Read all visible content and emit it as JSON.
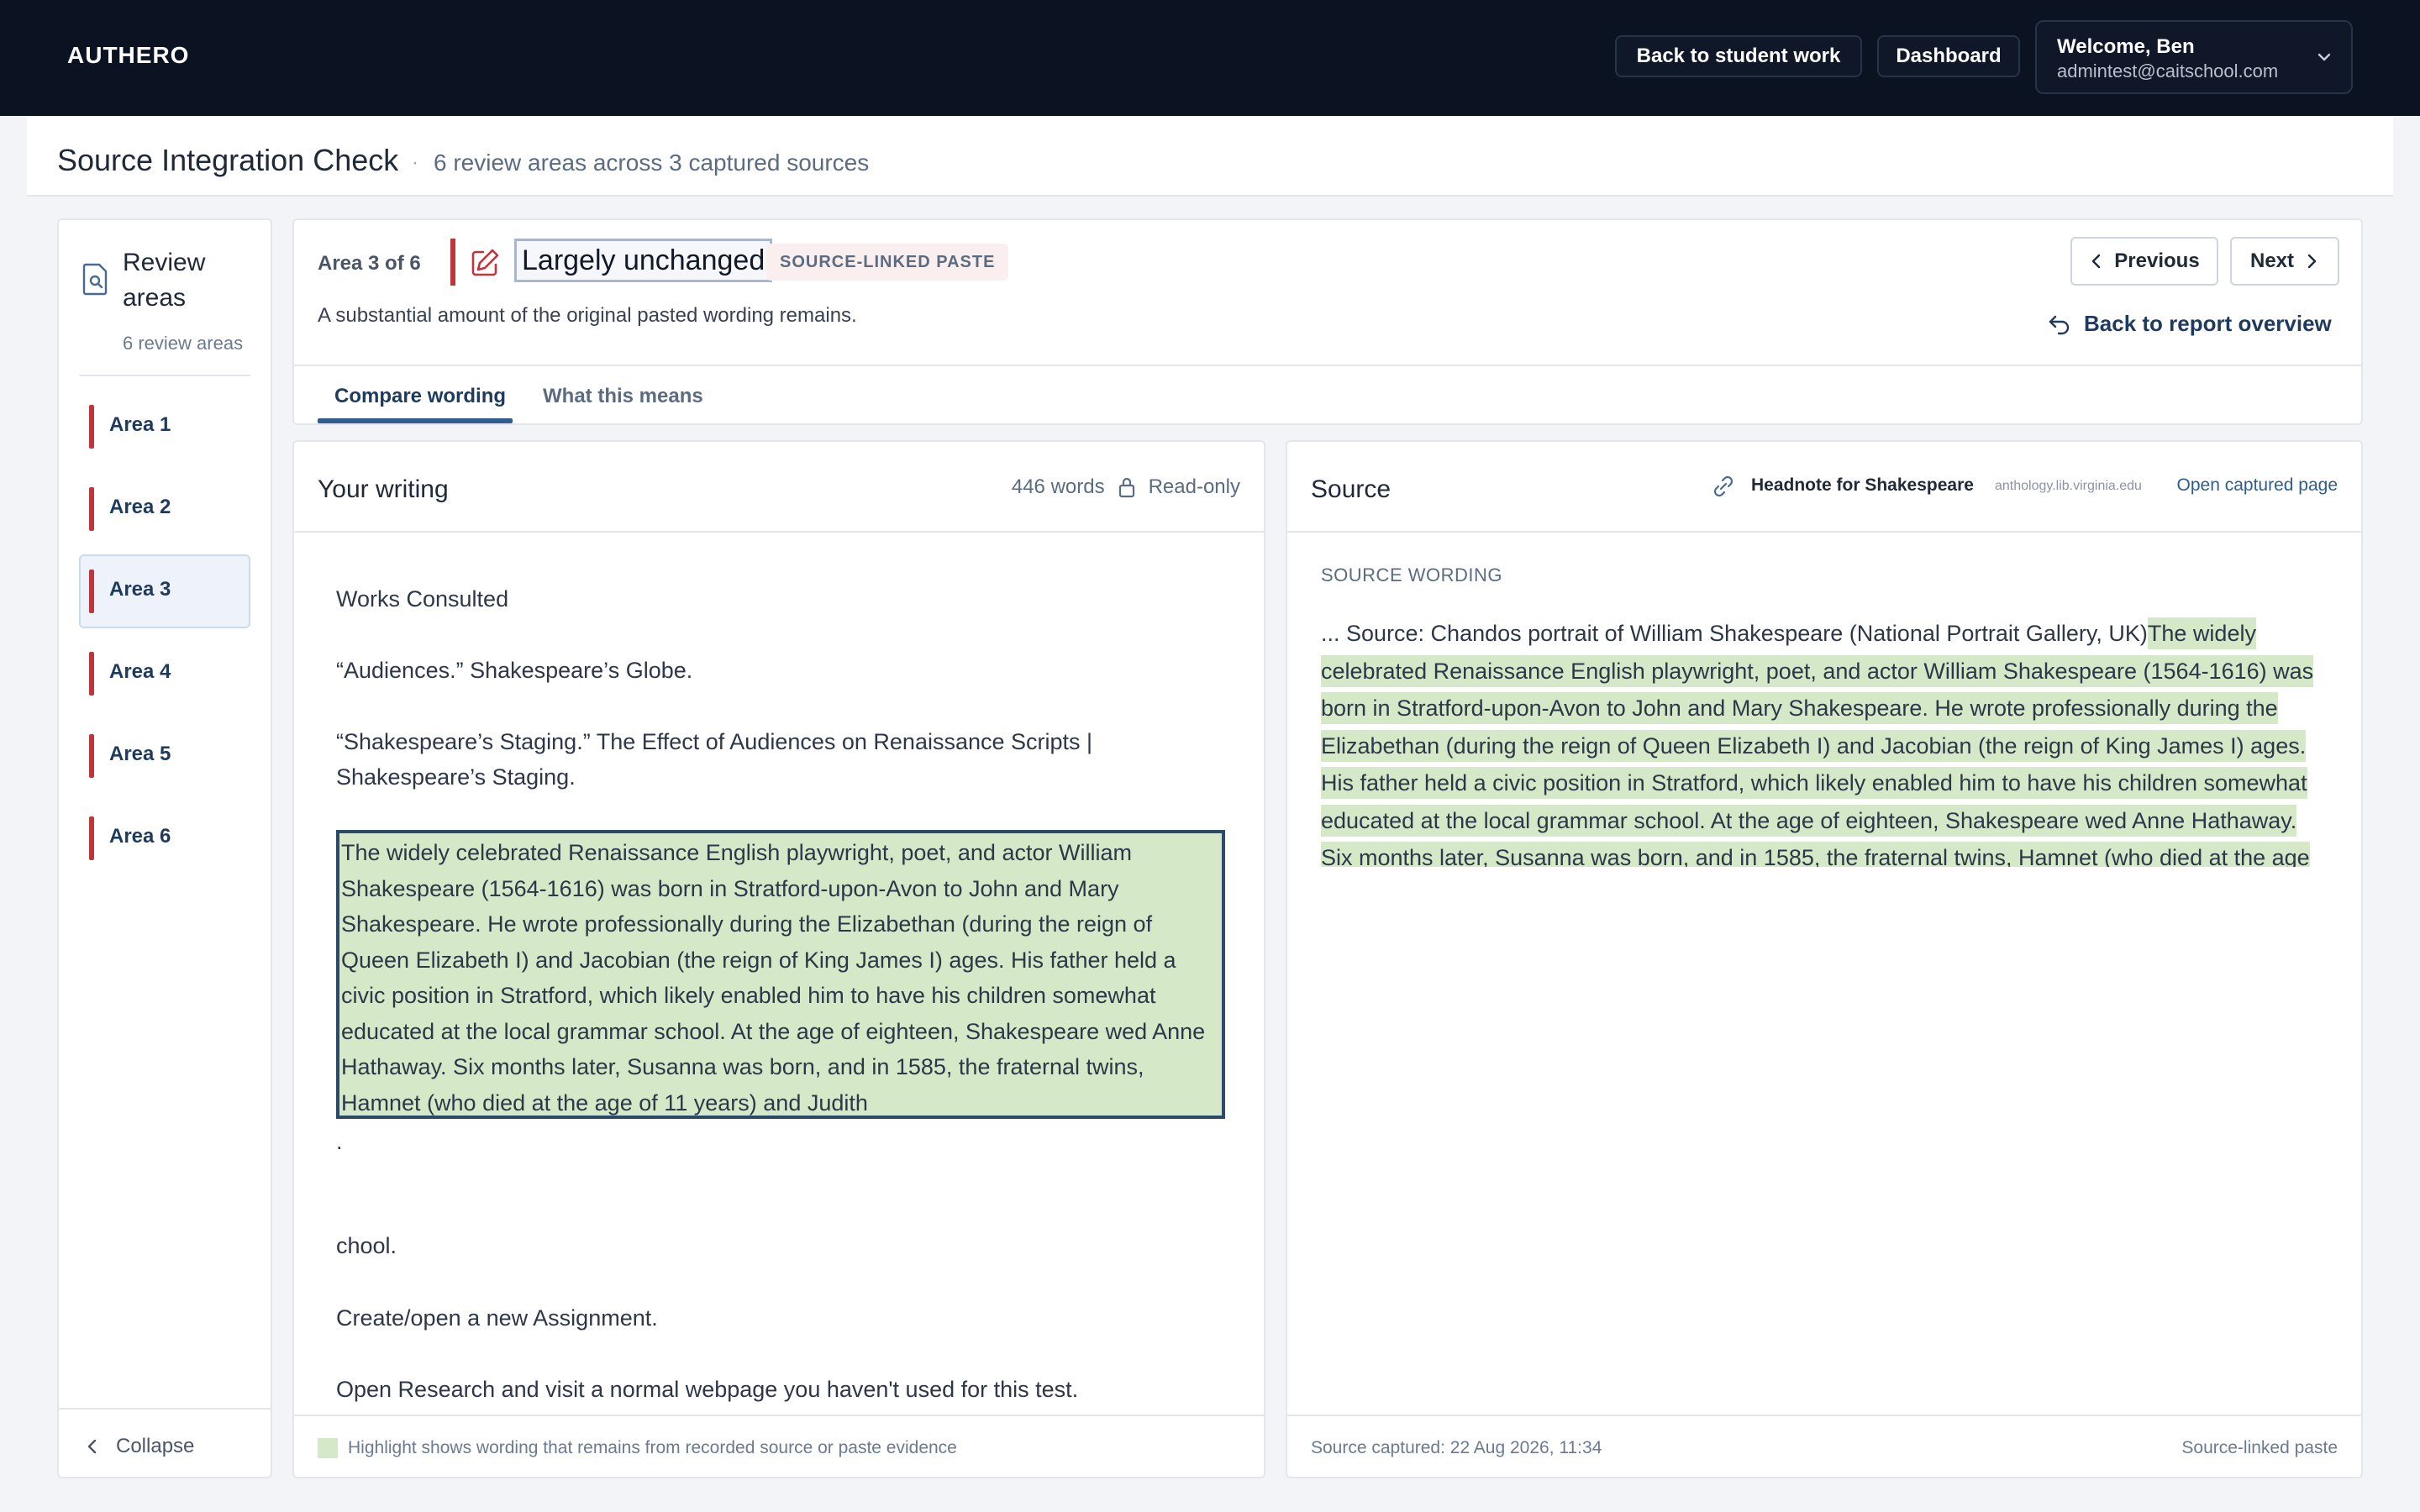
{
  "topbar": {
    "brand": "AUTHERO",
    "back_label": "Back to student work",
    "dashboard_label": "Dashboard",
    "user_greeting": "Welcome, Ben",
    "user_email": "admintest@caitschool.com"
  },
  "page": {
    "title": "Source Integration Check",
    "separator": "·",
    "subtitle": "6 review areas across 3 captured sources"
  },
  "sidebar": {
    "title": "Review areas",
    "count": "6 review areas",
    "items": [
      {
        "label": "Area 1"
      },
      {
        "label": "Area 2"
      },
      {
        "label": "Area 3"
      },
      {
        "label": "Area 4"
      },
      {
        "label": "Area 5"
      },
      {
        "label": "Area 6"
      }
    ],
    "active_index": 2,
    "collapse_label": "Collapse"
  },
  "area": {
    "counter": "Area 3 of 6",
    "status": "Largely unchanged",
    "badge": "SOURCE-LINKED PASTE",
    "description": "A substantial amount of the original pasted wording remains.",
    "prev_label": "Previous",
    "next_label": "Next",
    "back_report_label": "Back to report overview",
    "tabs": [
      {
        "label": "Compare wording"
      },
      {
        "label": "What this means"
      }
    ],
    "accent_color": "#c0353a"
  },
  "writing": {
    "title": "Your writing",
    "word_count": "446 words",
    "mode": "Read-only",
    "paragraphs": {
      "works": "Works Consulted",
      "audiences": "“Audiences.” Shakespeare’s Globe.",
      "staging": "“Shakespeare’s Staging.” The Effect of Audiences on Renaissance Scripts | Shakespeare’s Staging.",
      "highlight": "The widely celebrated Renaissance English playwright, poet, and actor William Shakespeare (1564-1616) was born in Stratford-upon-Avon to John and Mary Shakespeare. He wrote professionally during the Elizabethan (during the reign of Queen Elizabeth I) and Jacobian (the reign of King James I) ages. His father held a civic position in Stratford, which likely enabled him to have his children somewhat educated at the local grammar school. At the age of eighteen, Shakespeare wed Anne Hathaway. Six months later, Susanna was born, and in 1585, the fraternal twins, Hamnet (who died at the age of 11 years) and Judith",
      "dot": ".",
      "chool": "chool.",
      "create": "Create/open a new Assignment.",
      "open": "Open Research and visit a normal webpage you haven't used for this test."
    },
    "legend": "Highlight shows wording that remains from recorded source or paste evidence",
    "highlight_color": "#d5e8c7"
  },
  "source": {
    "title": "Source",
    "name": "Headnote for Shakespeare",
    "domain": "anthology.lib.virginia.edu",
    "open_label": "Open captured page",
    "section_label": "SOURCE WORDING",
    "prefix": "...        Source: Chandos portrait of William Shakespeare (National Portrait Gallery, UK)",
    "highlighted": "The widely celebrated Renaissance English playwright, poet, and actor William Shakespeare (1564-1616) was born in Stratford-upon-Avon to John and Mary Shakespeare. He wrote professionally during the Elizabethan (during the reign of Queen Elizabeth I) and Jacobian (the reign of King James I) ages. His father held a civic position in Stratford, which likely enabled him to have his children somewhat educated at the local grammar school. At the age of eighteen, Shakespeare wed Anne Hathaway. Six months later, Susanna was born, and in 1585, the fraternal twins, Hamnet (who died at the age",
    "captured": "Source captured: 22 Aug 2026, 11:34",
    "type": "Source-linked paste"
  }
}
